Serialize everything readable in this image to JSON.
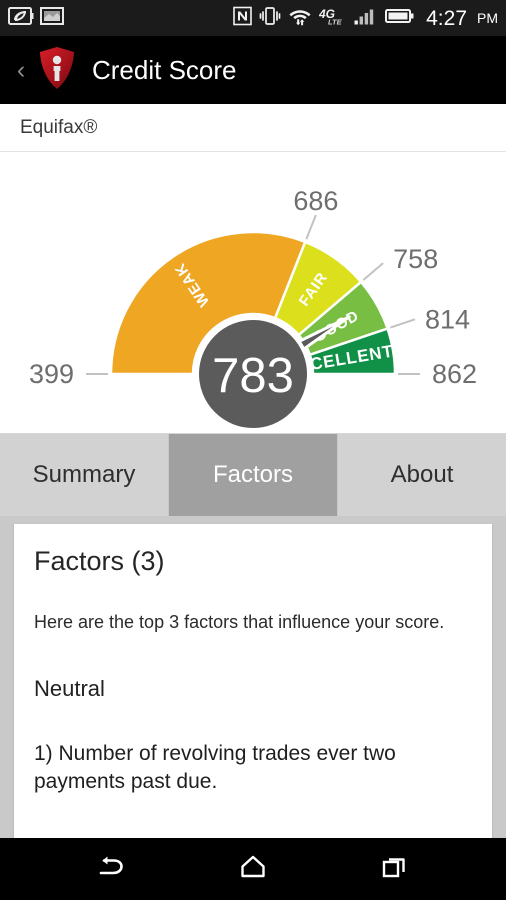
{
  "status_bar": {
    "icons_left": [
      "eco-battery-icon",
      "screenshot-icon"
    ],
    "icons_right": [
      "nfc-icon",
      "vibrate-icon",
      "wifi-icon",
      "4glte-icon",
      "signal-bars-icon",
      "battery-icon"
    ],
    "network_label": "4G",
    "network_sub": "LTE",
    "time": "4:27",
    "ampm": "PM"
  },
  "header": {
    "back_label": "‹",
    "logo": "shield-i-logo",
    "title": "Credit Score"
  },
  "bureau": {
    "name": "Equifax®"
  },
  "chart_data": {
    "type": "gauge",
    "title": "Credit Score",
    "value": 783,
    "min": 399,
    "max": 862,
    "axis_labels": [
      "399",
      "686",
      "758",
      "814",
      "862"
    ],
    "bands": [
      {
        "label": "WEAK",
        "from": 399,
        "to": 686,
        "color": "#EFA623"
      },
      {
        "label": "FAIR",
        "from": 686,
        "to": 758,
        "color": "#DCE01C"
      },
      {
        "label": "GOOD",
        "from": 758,
        "to": 814,
        "color": "#78BE43"
      },
      {
        "label": "EXCELLENT",
        "from": 814,
        "to": 862,
        "color": "#119147"
      }
    ],
    "needle_color": "#5B5B5B",
    "hub_color": "#5B5B5B",
    "hub_text_color": "#FFFFFF",
    "label_color": "#6E6E6E"
  },
  "tabs": [
    {
      "label": "Summary",
      "active": false
    },
    {
      "label": "Factors",
      "active": true
    },
    {
      "label": "About",
      "active": false
    }
  ],
  "content": {
    "title": "Factors (3)",
    "intro": "Here are the top 3 factors that influence your score.",
    "rating": "Neutral",
    "items": [
      "1) Number of revolving trades ever two payments past due."
    ]
  },
  "nav_bar": {
    "buttons": [
      "back-icon",
      "home-icon",
      "recents-icon"
    ]
  }
}
